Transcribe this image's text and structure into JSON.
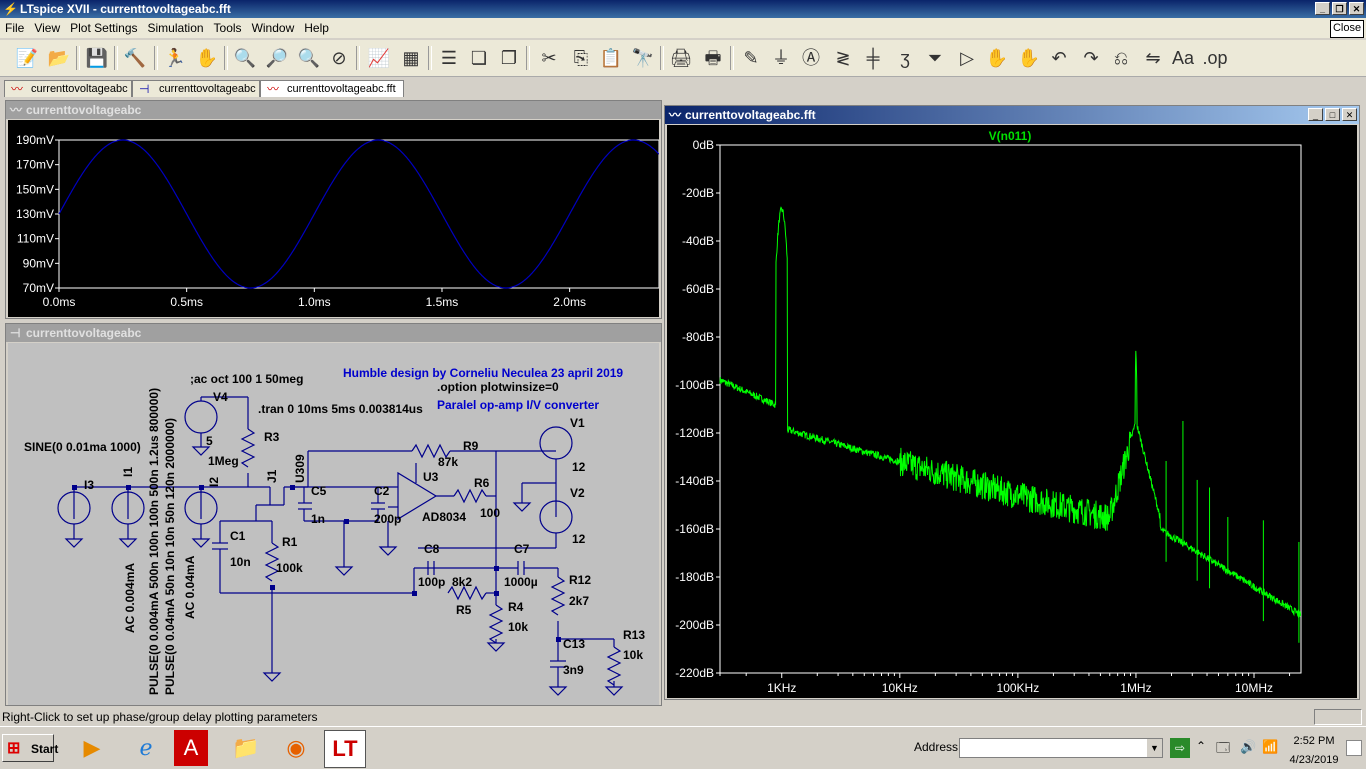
{
  "window": {
    "title": "LTspice XVII - currenttovoltageabc.fft"
  },
  "menu": [
    "File",
    "View",
    "Plot Settings",
    "Simulation",
    "Tools",
    "Window",
    "Help"
  ],
  "close_tip": "Close",
  "tabs": [
    {
      "label": "currenttovoltageabc"
    },
    {
      "label": "currenttovoltageabc"
    },
    {
      "label": "currenttovoltageabc.fft"
    }
  ],
  "time_pane": {
    "title": "currenttovoltageabc",
    "chart_data": {
      "type": "line",
      "x_unit": "ms",
      "y_ticks": [
        "190mV",
        "170mV",
        "150mV",
        "130mV",
        "110mV",
        "90mV",
        "70mV"
      ],
      "x_ticks": [
        "0.0ms",
        "0.5ms",
        "1.0ms",
        "1.5ms",
        "2.0ms"
      ],
      "ylim": [
        70,
        190
      ],
      "xlim": [
        0,
        2.35
      ],
      "series": [
        {
          "offset_mV": 130,
          "amplitude_mV": 60,
          "period_ms": 1.0
        }
      ],
      "line_color": "#0000c0"
    }
  },
  "schematic": {
    "title": "currenttovoltageabc",
    "notes": {
      "author": "Humble design by Corneliu Neculea 23 april 2019",
      "option": ".option plotwinsize=0",
      "desc": "Paralel op-amp I/V converter",
      "ac": ";ac oct 100 1 50meg",
      "tran": ".tran 0 10ms 5ms 0.003814us",
      "sine": "SINE(0 0.01ma 1000)",
      "pulse1": "PULSE(0 0.004mA 500n 100n 100n 500n 1.2us 800000)",
      "pulse2": "PULSE(0 0.04mA 50n 10n 10n 50n 120n 2000000)",
      "ac1": "AC 0.004mA",
      "ac2": "AC 0.04mA"
    },
    "labels": {
      "V4": "V4",
      "v4val": "5",
      "R3": "R3",
      "r3val": "1Meg",
      "I3": "I3",
      "I1": "I1",
      "I2": "I2",
      "J1": "J1",
      "U309": "U309",
      "C5": "C5",
      "c5val": "1n",
      "C2": "C2",
      "c2val": "200p",
      "C1": "C1",
      "c1val": "10n",
      "R1": "R1",
      "r1val": "100k",
      "R9": "R9",
      "r9val": "87k",
      "U3": "U3",
      "u3val": "AD8034",
      "R6": "R6",
      "r6val": "100",
      "V1": "V1",
      "v1val": "12",
      "V2": "V2",
      "v2val": "12",
      "C8": "C8",
      "c8val": "100p",
      "R5": "R5",
      "r5val": "8k2",
      "C7": "C7",
      "c7val": "1000µ",
      "R4": "R4",
      "r4val": "10k",
      "R12": "R12",
      "r12val": "2k7",
      "C13": "C13",
      "c13val": "3n9",
      "R13": "R13",
      "r13val": "10k"
    }
  },
  "fft_pane": {
    "title": "currenttovoltageabc.fft",
    "chart_data": {
      "type": "line",
      "title": "V(n011)",
      "y_ticks": [
        "0dB",
        "-20dB",
        "-40dB",
        "-60dB",
        "-80dB",
        "-100dB",
        "-120dB",
        "-140dB",
        "-160dB",
        "-180dB",
        "-200dB",
        "-220dB"
      ],
      "x_ticks": [
        "1KHz",
        "10KHz",
        "100KHz",
        "1MHz",
        "10MHz"
      ],
      "ylim": [
        -220,
        0
      ],
      "x_scale": "log",
      "xlim_hz": [
        300,
        25000000
      ],
      "features": [
        {
          "freq_hz": 1000,
          "peak_db": -27
        },
        {
          "freq_hz": 1000000,
          "peak_db": -85
        },
        {
          "freq_hz": 2500000,
          "peak_db": -115
        },
        {
          "freq_hz": 6000000,
          "peak_db": -155
        }
      ],
      "line_color": "#00ff00"
    }
  },
  "status": "Right-Click to set up phase/group delay plotting parameters",
  "taskbar": {
    "start": "Start",
    "address_label": "Address",
    "time": "2:52 PM",
    "date": "4/23/2019"
  }
}
